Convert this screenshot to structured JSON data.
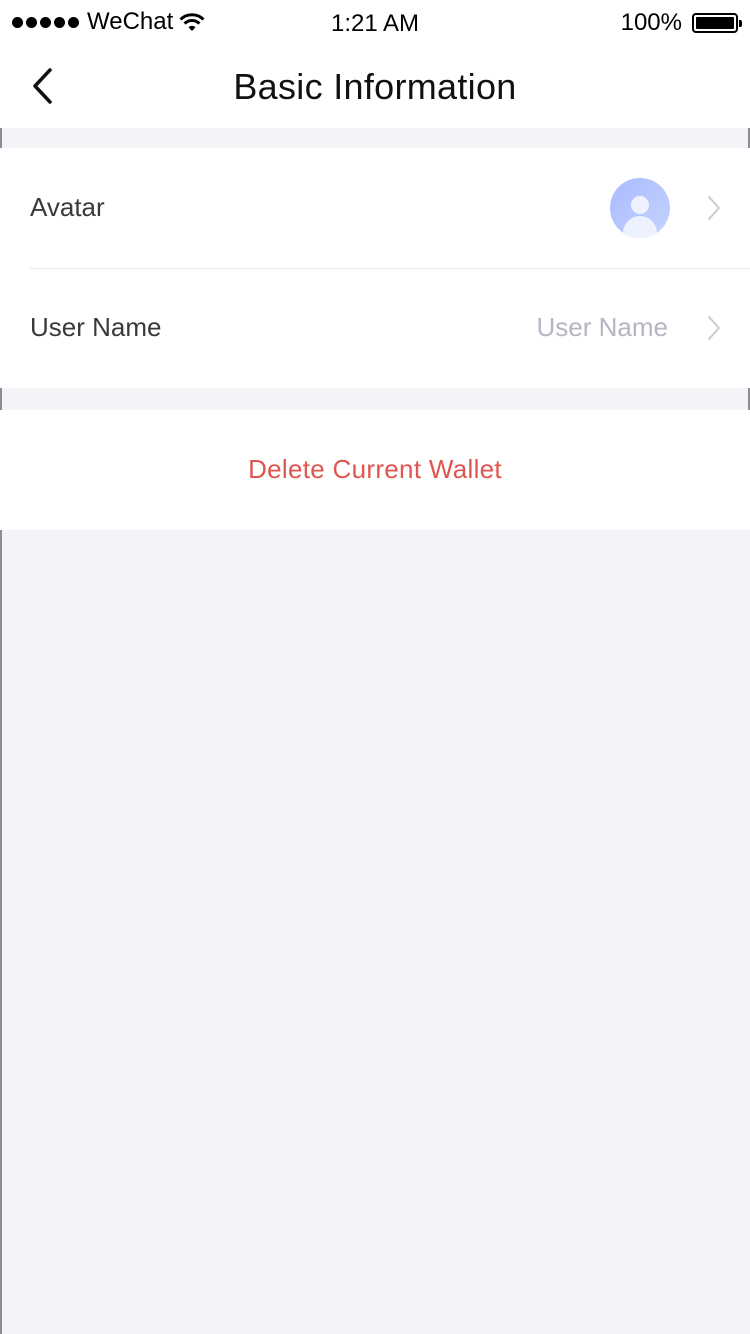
{
  "status_bar": {
    "carrier": "WeChat",
    "time": "1:21 AM",
    "battery": "100%"
  },
  "nav": {
    "title": "Basic Information"
  },
  "rows": {
    "avatar": {
      "label": "Avatar"
    },
    "username": {
      "label": "User Name",
      "value": "User Name"
    }
  },
  "actions": {
    "delete_label": "Delete Current Wallet"
  },
  "colors": {
    "background": "#f3f4f8",
    "danger": "#e0554f",
    "placeholder": "#b4b7c3",
    "avatar_accent": "#a8bbfd"
  }
}
